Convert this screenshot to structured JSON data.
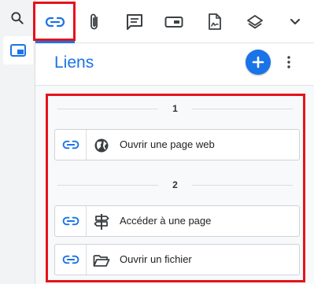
{
  "toolbar": {
    "tabs": [
      {
        "name": "links",
        "icon": "link-icon",
        "active": true
      },
      {
        "name": "attachments",
        "icon": "paperclip-icon"
      },
      {
        "name": "comments",
        "icon": "comment-icon"
      },
      {
        "name": "fields",
        "icon": "form-field-icon"
      },
      {
        "name": "signatures",
        "icon": "signature-document-icon"
      },
      {
        "name": "layers",
        "icon": "layers-icon"
      },
      {
        "name": "more",
        "icon": "chevron-down-icon"
      }
    ]
  },
  "left_rail": {
    "search_icon": "search-icon",
    "panel_icon": "panel-icon"
  },
  "panel": {
    "title": "Liens",
    "add_icon": "plus-icon",
    "more_icon": "kebab-menu-icon"
  },
  "groups": [
    {
      "label": "1",
      "items": [
        {
          "label": "Ouvrir une page web",
          "icon": "globe-icon"
        }
      ]
    },
    {
      "label": "2",
      "items": [
        {
          "label": "Accéder à une page",
          "icon": "signpost-icon"
        },
        {
          "label": "Ouvrir un fichier",
          "icon": "folder-open-icon"
        }
      ]
    }
  ],
  "colors": {
    "accent": "#1a73e8",
    "highlight": "#e5121b"
  }
}
